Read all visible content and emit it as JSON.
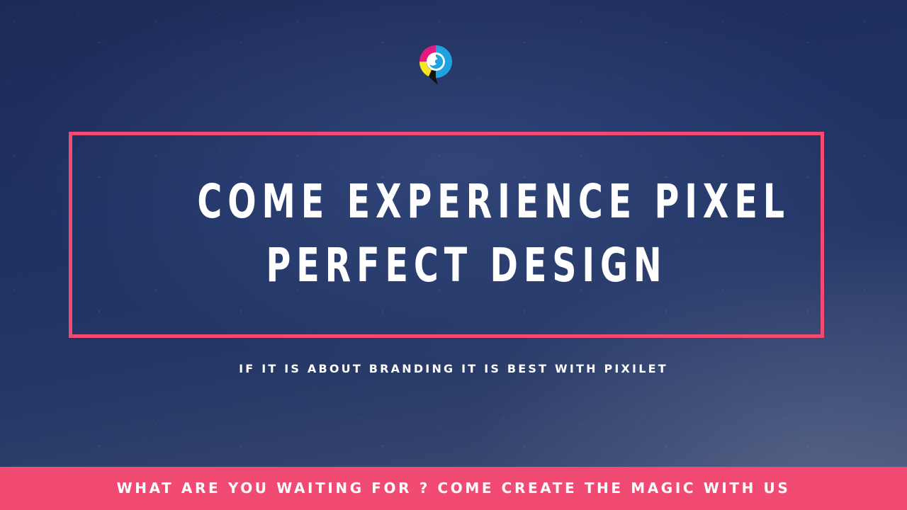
{
  "logo": {
    "icon": "pixilet-logo-icon",
    "colors": {
      "magenta": "#e6197e",
      "cyan": "#1ea3e0",
      "yellow": "#f7e51d",
      "black": "#111111"
    }
  },
  "headline": {
    "line1": "COME EXPERIENCE PIXEL",
    "line2": "PERFECT DESIGN"
  },
  "tagline": "IF IT IS ABOUT BRANDING IT IS BEST WITH PIXILET",
  "footer": {
    "text": "WHAT ARE YOU WAITING FOR ? COME CREATE THE MAGIC WITH US"
  },
  "colors": {
    "accent": "#f24b73",
    "background": "#1f3163",
    "text": "#ffffff"
  }
}
